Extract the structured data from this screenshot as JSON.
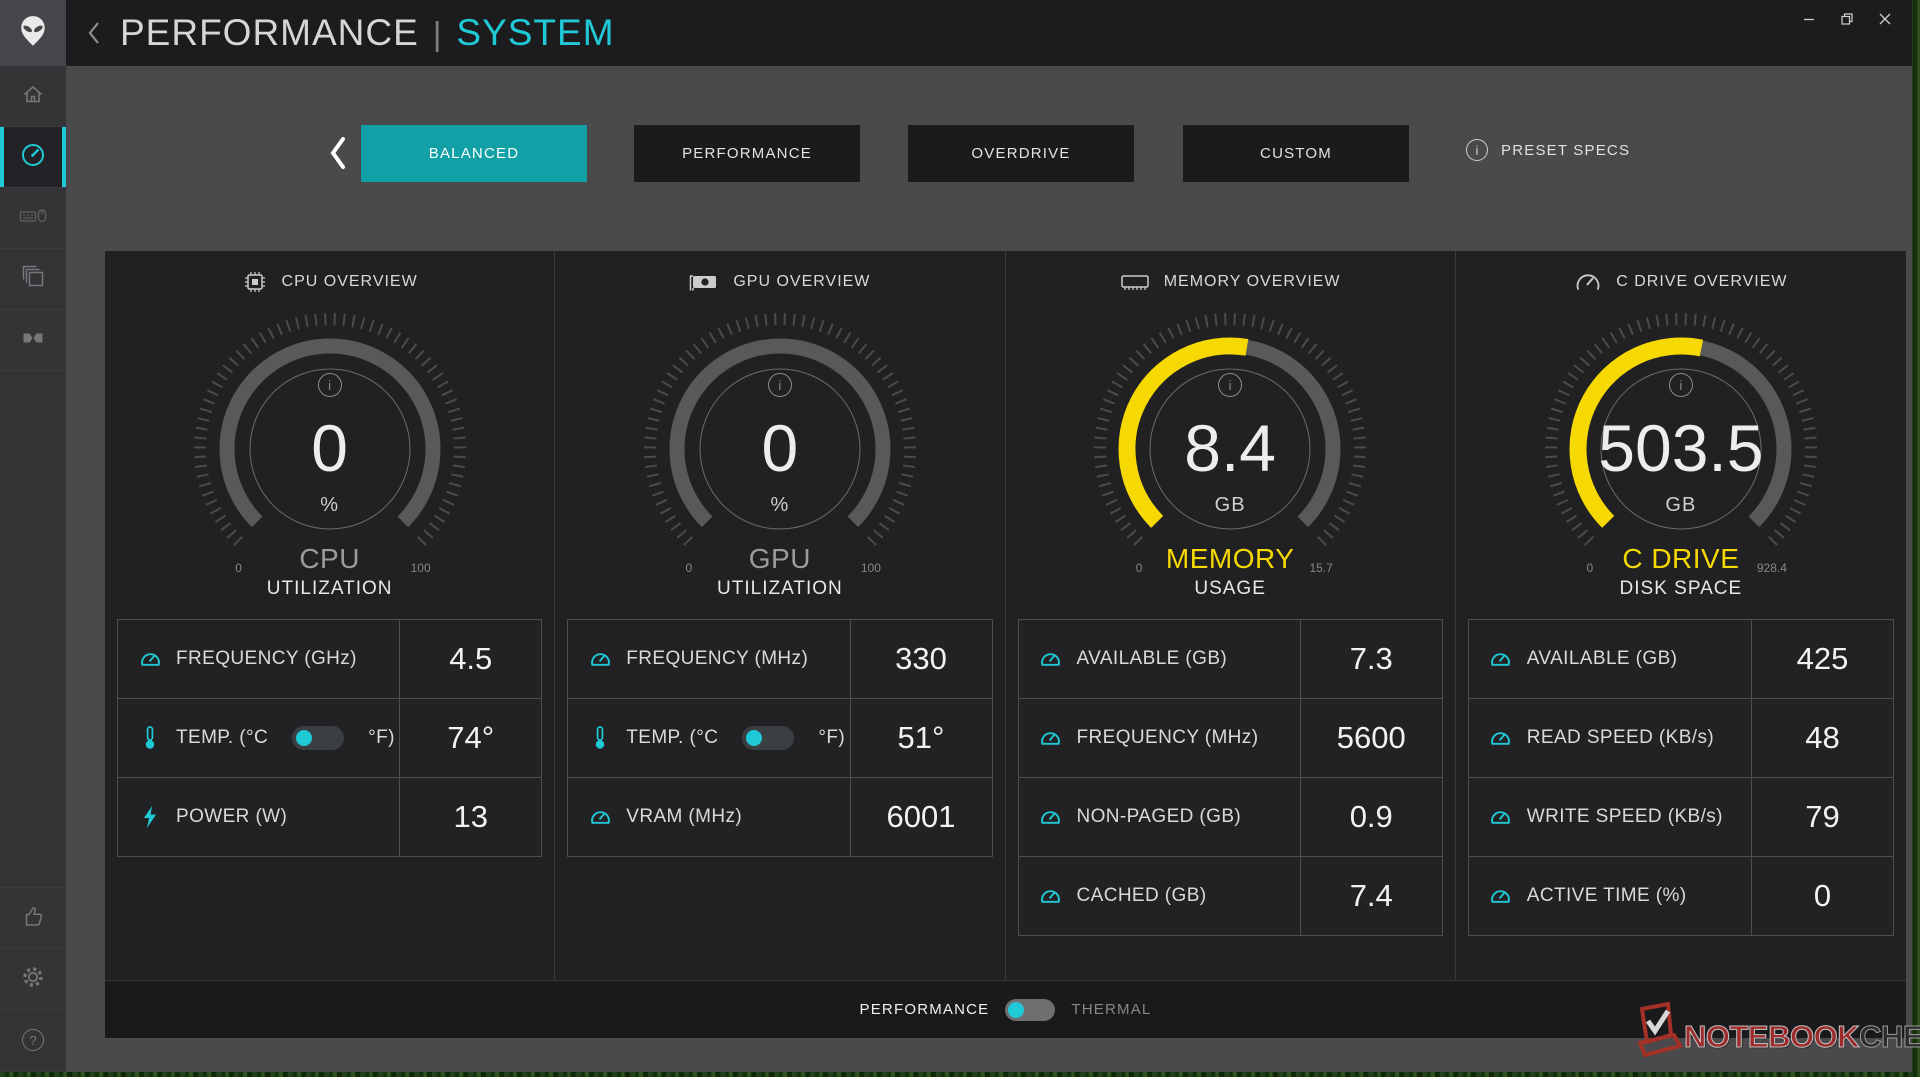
{
  "colors": {
    "accent_cyan": "#1fc9d6",
    "teal_button": "#11a0a6",
    "gauge_yellow": "#f6d903"
  },
  "window": {
    "back_chevron": "chevron-left",
    "title_left": "PERFORMANCE",
    "title_divider": "|",
    "title_right": "SYSTEM"
  },
  "sidebar": {
    "top_icons": [
      "alienware-logo-icon",
      "home-icon",
      "performance-gauge-icon",
      "peripherals-icon",
      "library-icon",
      "alienfx-icon"
    ],
    "active_icon": "performance-gauge-icon",
    "bottom_icons": [
      "thumbs-up-icon",
      "settings-gear-icon",
      "help-icon"
    ],
    "help_glyph": "?"
  },
  "presets": {
    "buttons": [
      {
        "label": "BALANCED",
        "active": true
      },
      {
        "label": "PERFORMANCE",
        "active": false
      },
      {
        "label": "OVERDRIVE",
        "active": false
      },
      {
        "label": "CUSTOM",
        "active": false
      }
    ],
    "specs_label": "PRESET SPECS",
    "info_glyph": "i"
  },
  "overview_columns": [
    {
      "header": "CPU OVERVIEW",
      "header_icon": "cpu-chip-icon",
      "gauge": {
        "value": "0",
        "unit": "%",
        "label1": "CPU",
        "label2": "UTILIZATION",
        "min": "0",
        "max": "100",
        "fill_color": "",
        "label1_color": "#9c9c9e",
        "info_glyph": "i"
      },
      "rows": [
        {
          "icon": "gauge-icon",
          "label": "FREQUENCY (GHz)",
          "value": "4.5"
        },
        {
          "icon": "thermometer-icon",
          "label": "TEMP. (°C",
          "suffix": "°F)",
          "toggle": true,
          "value": "74°"
        },
        {
          "icon": "power-bolt-icon",
          "label": "POWER (W)",
          "value": "13"
        }
      ]
    },
    {
      "header": "GPU OVERVIEW",
      "header_icon": "gpu-card-icon",
      "gauge": {
        "value": "0",
        "unit": "%",
        "label1": "GPU",
        "label2": "UTILIZATION",
        "min": "0",
        "max": "100",
        "fill_color": "",
        "label1_color": "#9c9c9e",
        "info_glyph": "i"
      },
      "rows": [
        {
          "icon": "gauge-icon",
          "label": "FREQUENCY (MHz)",
          "value": "330"
        },
        {
          "icon": "thermometer-icon",
          "label": "TEMP. (°C",
          "suffix": "°F)",
          "toggle": true,
          "value": "51°"
        },
        {
          "icon": "gauge-icon",
          "label": "VRAM (MHz)",
          "value": "6001"
        }
      ]
    },
    {
      "header": "MEMORY OVERVIEW",
      "header_icon": "memory-ram-icon",
      "gauge": {
        "value": "8.4",
        "unit": "GB",
        "label1": "MEMORY",
        "label2": "USAGE",
        "min": "0",
        "max": "15.7",
        "fill_color": "#f6d903",
        "label1_color": "#f6d903",
        "info_glyph": "i"
      },
      "rows": [
        {
          "icon": "gauge-icon",
          "label": "AVAILABLE (GB)",
          "value": "7.3"
        },
        {
          "icon": "gauge-icon",
          "label": "FREQUENCY (MHz)",
          "value": "5600"
        },
        {
          "icon": "gauge-icon",
          "label": "NON-PAGED (GB)",
          "value": "0.9"
        },
        {
          "icon": "gauge-icon",
          "label": "CACHED (GB)",
          "value": "7.4"
        }
      ]
    },
    {
      "header": "C DRIVE OVERVIEW",
      "header_icon": "drive-gauge-icon",
      "gauge": {
        "value": "503.5",
        "unit": "GB",
        "label1": "C DRIVE",
        "label2": "DISK SPACE",
        "min": "0",
        "max": "928.4",
        "fill_color": "#f6d903",
        "label1_color": "#f6d903",
        "info_glyph": "i"
      },
      "rows": [
        {
          "icon": "gauge-icon",
          "label": "AVAILABLE (GB)",
          "value": "425"
        },
        {
          "icon": "gauge-icon",
          "label": "READ SPEED (KB/s)",
          "value": "48"
        },
        {
          "icon": "gauge-icon",
          "label": "WRITE SPEED (KB/s)",
          "value": "79"
        },
        {
          "icon": "gauge-icon",
          "label": "ACTIVE TIME (%)",
          "value": "0"
        }
      ]
    }
  ],
  "footer": {
    "left_label": "PERFORMANCE",
    "right_label": "THERMAL",
    "toggle_state": "left"
  },
  "watermark": {
    "text_primary": "NOTEBOOK",
    "text_secondary": "CHECK"
  }
}
